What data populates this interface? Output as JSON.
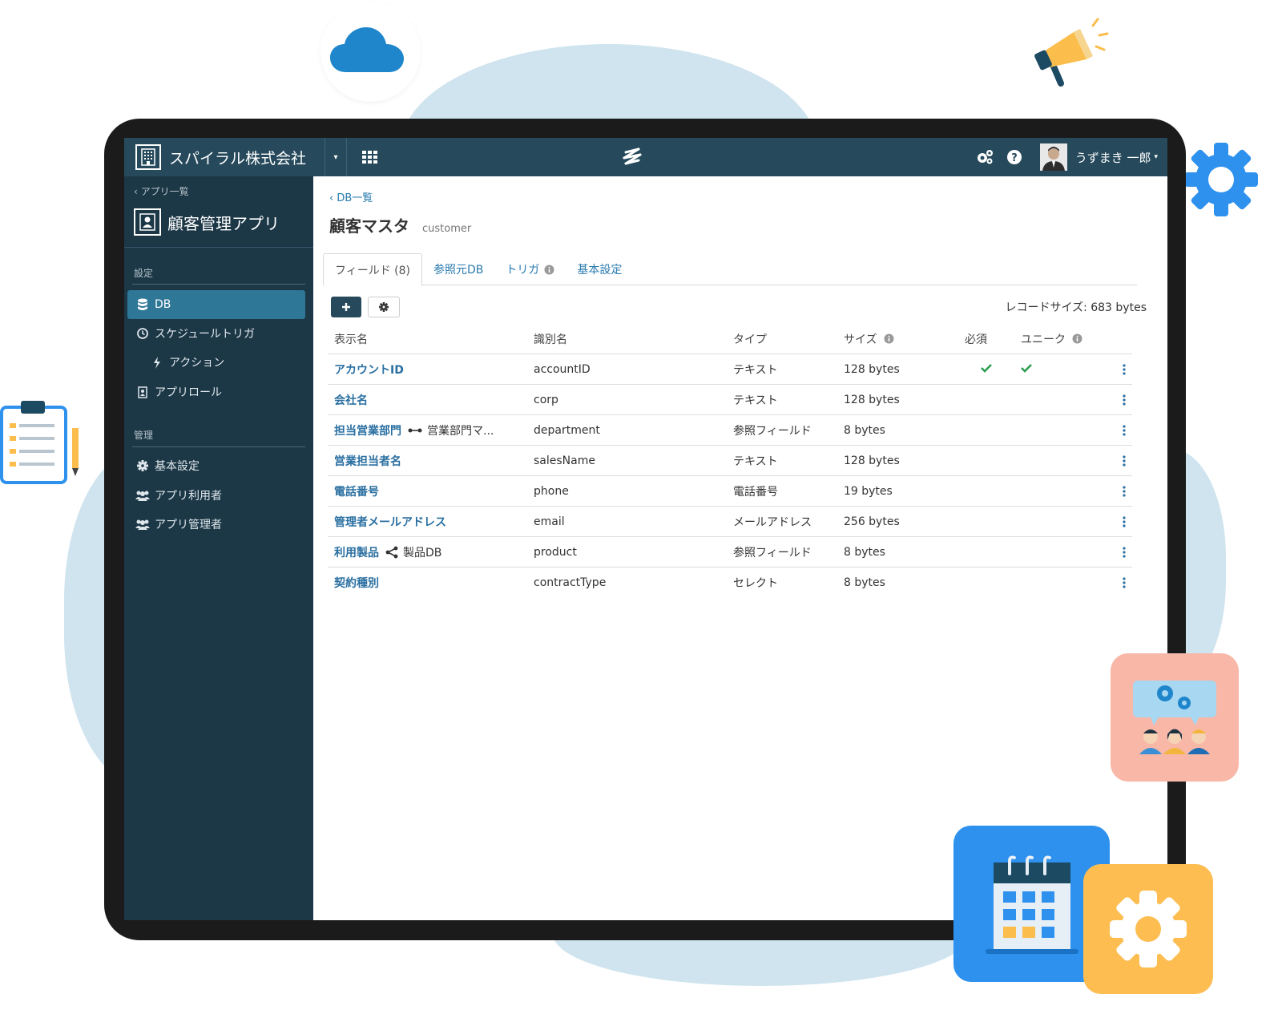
{
  "topbar": {
    "org_name": "スパイラル株式会社",
    "apps_icon": "grid-icon",
    "logo_icon": "spiral-logo-icon",
    "settings_icon": "gears-icon",
    "help_icon": "question-circle-icon",
    "user_name": "うずまき 一郎"
  },
  "sidebar": {
    "back_label": "‹ アプリ一覧",
    "app_title": "顧客管理アプリ",
    "section_settings": "設定",
    "section_admin": "管理",
    "items": [
      {
        "label": "DB",
        "icon": "database-icon",
        "active": true
      },
      {
        "label": "スケジュールトリガ",
        "icon": "clock-icon"
      },
      {
        "label": "アクション",
        "icon": "bolt-icon"
      },
      {
        "label": "アプリロール",
        "icon": "id-badge-icon"
      },
      {
        "label": "基本設定",
        "icon": "gear-icon"
      },
      {
        "label": "アプリ利用者",
        "icon": "users-icon"
      },
      {
        "label": "アプリ管理者",
        "icon": "users-icon"
      }
    ]
  },
  "main": {
    "back_label": "‹  DB一覧",
    "title": "顧客マスタ",
    "subtitle": "customer",
    "tabs": [
      {
        "label": "フィールド (8)",
        "active": true
      },
      {
        "label": "参照元DB"
      },
      {
        "label": "トリガ"
      },
      {
        "label": "基本設定"
      }
    ],
    "add_button_icon": "plus-icon",
    "settings_button_icon": "gear-icon",
    "record_size": "レコードサイズ: 683 bytes",
    "columns": {
      "display_name": "表示名",
      "identifier": "識別名",
      "type": "タイプ",
      "size": "サイズ",
      "required": "必須",
      "unique": "ユニーク"
    },
    "rows": [
      {
        "name": "アカウントID",
        "ref": "",
        "identifier": "accountID",
        "type": "テキスト",
        "size": "128 bytes",
        "required": true,
        "unique": true
      },
      {
        "name": "会社名",
        "ref": "",
        "identifier": "corp",
        "type": "テキスト",
        "size": "128 bytes",
        "required": false,
        "unique": false
      },
      {
        "name": "担当営業部門",
        "ref": "営業部門マ...",
        "ref_icon": "link-arrows-icon",
        "identifier": "department",
        "type": "参照フィールド",
        "size": "8 bytes",
        "required": false,
        "unique": false
      },
      {
        "name": "営業担当者名",
        "ref": "",
        "identifier": "salesName",
        "type": "テキスト",
        "size": "128 bytes",
        "required": false,
        "unique": false
      },
      {
        "name": "電話番号",
        "ref": "",
        "identifier": "phone",
        "type": "電話番号",
        "size": "19 bytes",
        "required": false,
        "unique": false
      },
      {
        "name": "管理者メールアドレス",
        "ref": "",
        "identifier": "email",
        "type": "メールアドレス",
        "size": "256 bytes",
        "required": false,
        "unique": false
      },
      {
        "name": "利用製品",
        "ref": "製品DB",
        "ref_icon": "share-nodes-icon",
        "identifier": "product",
        "type": "参照フィールド",
        "size": "8 bytes",
        "required": false,
        "unique": false
      },
      {
        "name": "契約種別",
        "ref": "",
        "identifier": "contractType",
        "type": "セレクト",
        "size": "8 bytes",
        "required": false,
        "unique": false
      }
    ]
  },
  "colors": {
    "topbar": "#264a5c",
    "sidebar": "#1c3746",
    "active_item": "#2f7797",
    "link": "#2a6fa1",
    "check": "#2e9e4f"
  }
}
